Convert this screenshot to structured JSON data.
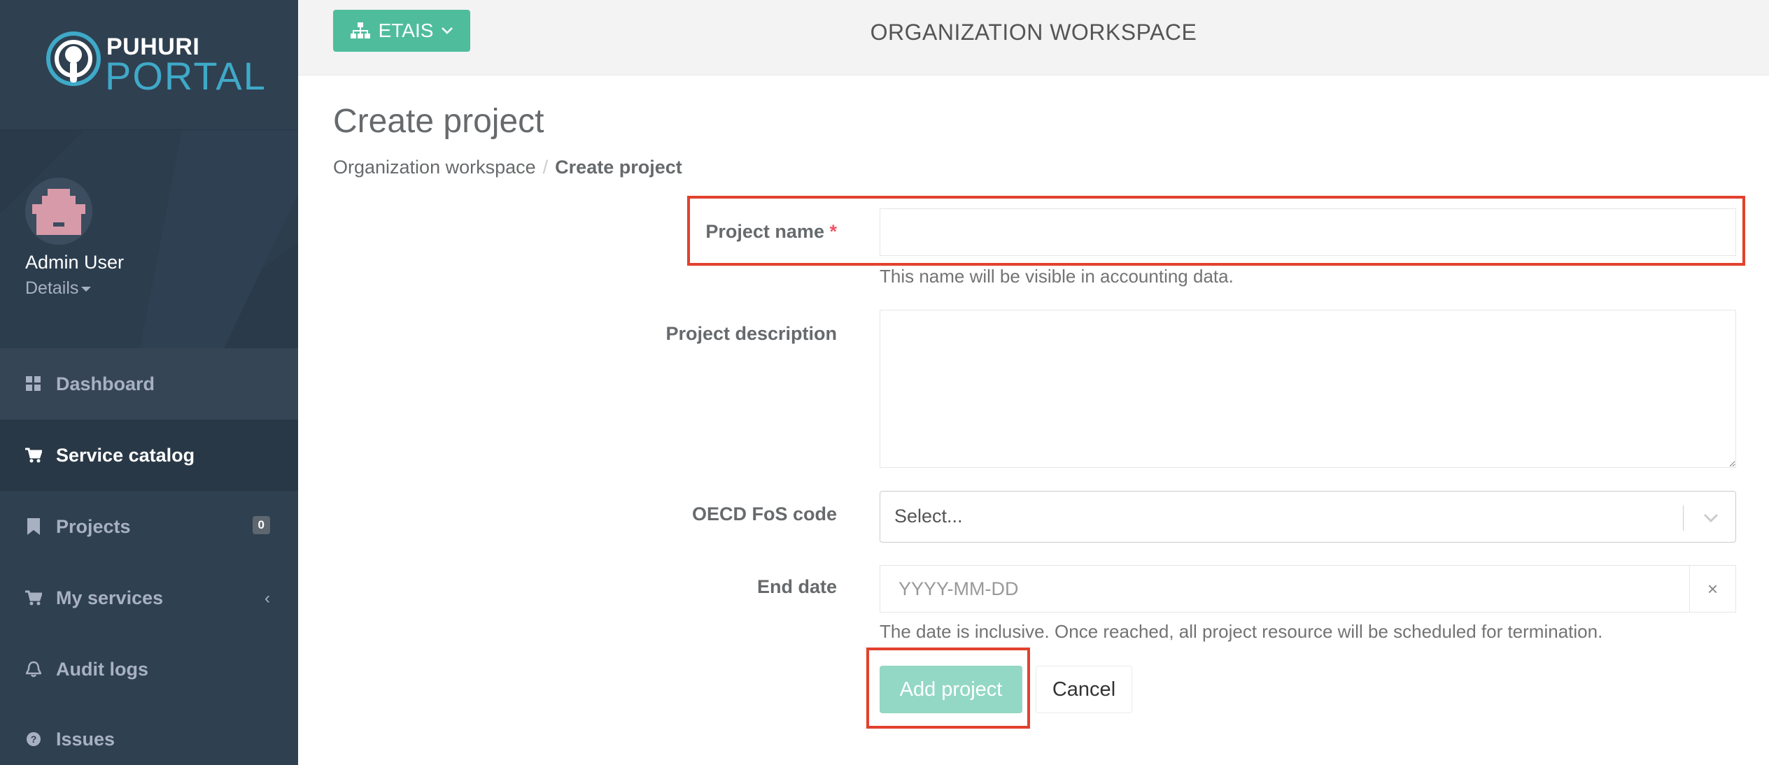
{
  "brand": {
    "line1": "PUHURI",
    "line2": "PORTAL"
  },
  "user": {
    "name": "Admin User",
    "details_label": "Details"
  },
  "sidebar": {
    "items": [
      {
        "label": "Dashboard",
        "icon": "dashboard-icon"
      },
      {
        "label": "Service catalog",
        "icon": "cart-icon",
        "active": true
      },
      {
        "label": "Projects",
        "icon": "bookmark-icon",
        "badge": "0"
      },
      {
        "label": "My services",
        "icon": "cart-icon",
        "expand": "‹"
      },
      {
        "label": "Audit logs",
        "icon": "bell-icon"
      },
      {
        "label": "Issues",
        "icon": "question-circle-icon"
      }
    ]
  },
  "topbar": {
    "org_button": "ETAIS",
    "workspace_title": "ORGANIZATION WORKSPACE"
  },
  "page": {
    "title": "Create project",
    "breadcrumb": {
      "parent": "Organization workspace",
      "separator": "/",
      "current": "Create project"
    }
  },
  "form": {
    "project_name": {
      "label": "Project name",
      "required_mark": "*",
      "value": "",
      "help": "This name will be visible in accounting data."
    },
    "project_description": {
      "label": "Project description",
      "value": ""
    },
    "oecd_code": {
      "label": "OECD FoS code",
      "placeholder": "Select..."
    },
    "end_date": {
      "label": "End date",
      "placeholder": "YYYY-MM-DD",
      "clear": "×",
      "help": "The date is inclusive. Once reached, all project resource will be scheduled for termination."
    },
    "submit_label": "Add project",
    "cancel_label": "Cancel"
  },
  "colors": {
    "sidebar": "#2f4050",
    "accent": "#4fbd9c",
    "highlight": "#e2412e"
  }
}
